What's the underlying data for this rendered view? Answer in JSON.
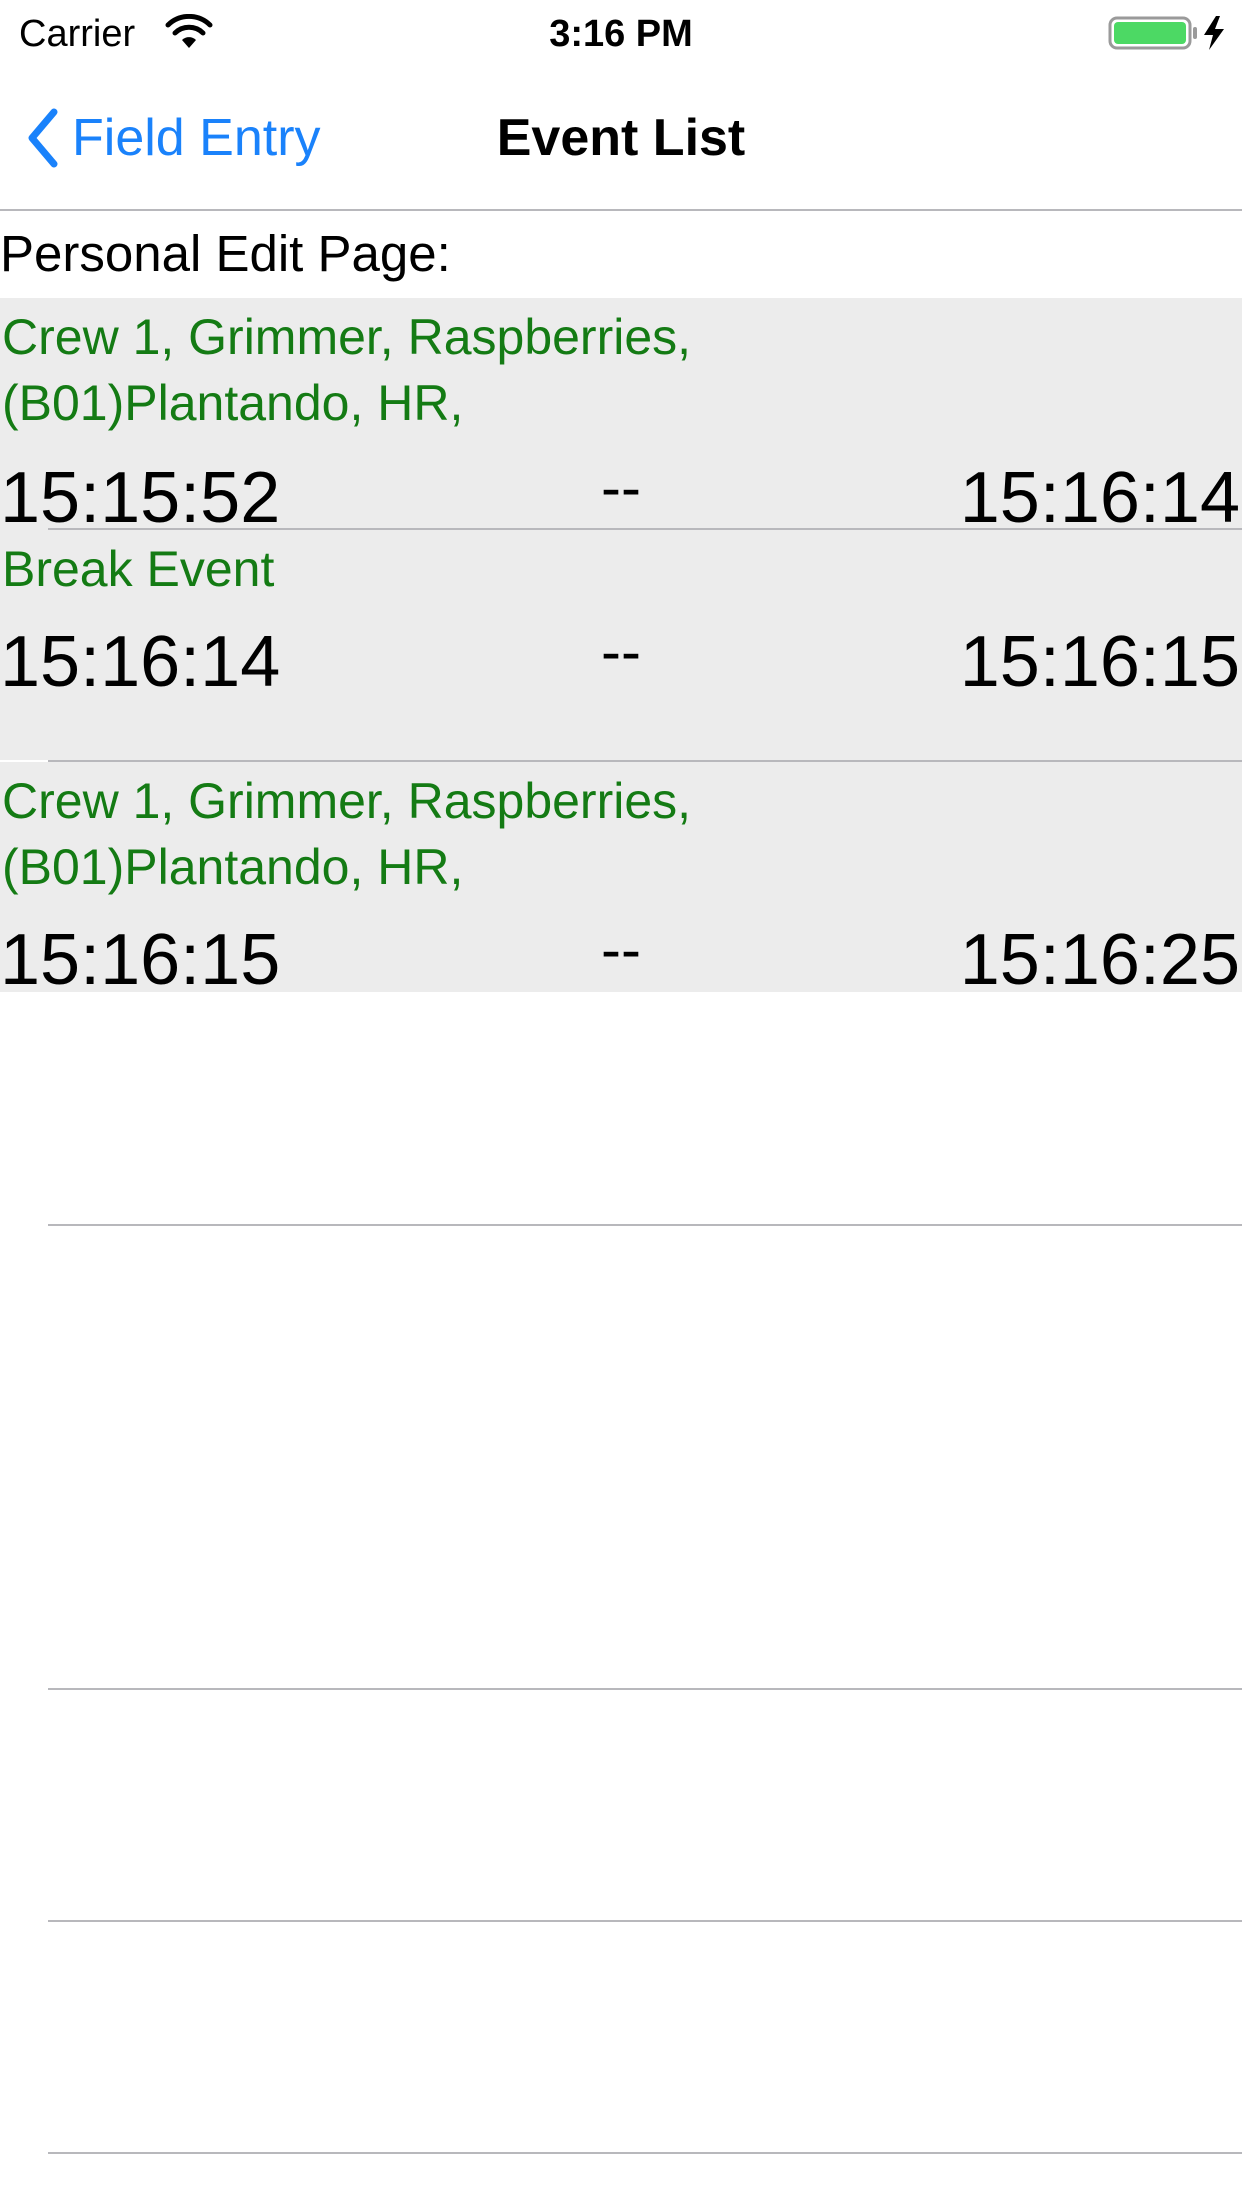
{
  "status_bar": {
    "carrier": "Carrier",
    "time": "3:16 PM"
  },
  "nav": {
    "back_label": "Field Entry",
    "title": "Event List"
  },
  "header": {
    "label": "Personal Edit Page:"
  },
  "events": [
    {
      "title": "Crew 1, Grimmer, Raspberries,\n(B01)Plantando, HR,",
      "start": "15:15:52",
      "separator": "--",
      "end": "15:16:14"
    },
    {
      "title": "Break Event",
      "start": "15:16:14",
      "separator": "--",
      "end": "15:16:15"
    },
    {
      "title": "Crew 1, Grimmer, Raspberries,\n(B01)Plantando, HR,",
      "start": "15:16:15",
      "separator": "--",
      "end": "15:16:25"
    }
  ],
  "colors": {
    "accent": "#1a82fb",
    "event_text": "#147b14",
    "row_background": "#ececec",
    "battery": "#4cd964"
  }
}
